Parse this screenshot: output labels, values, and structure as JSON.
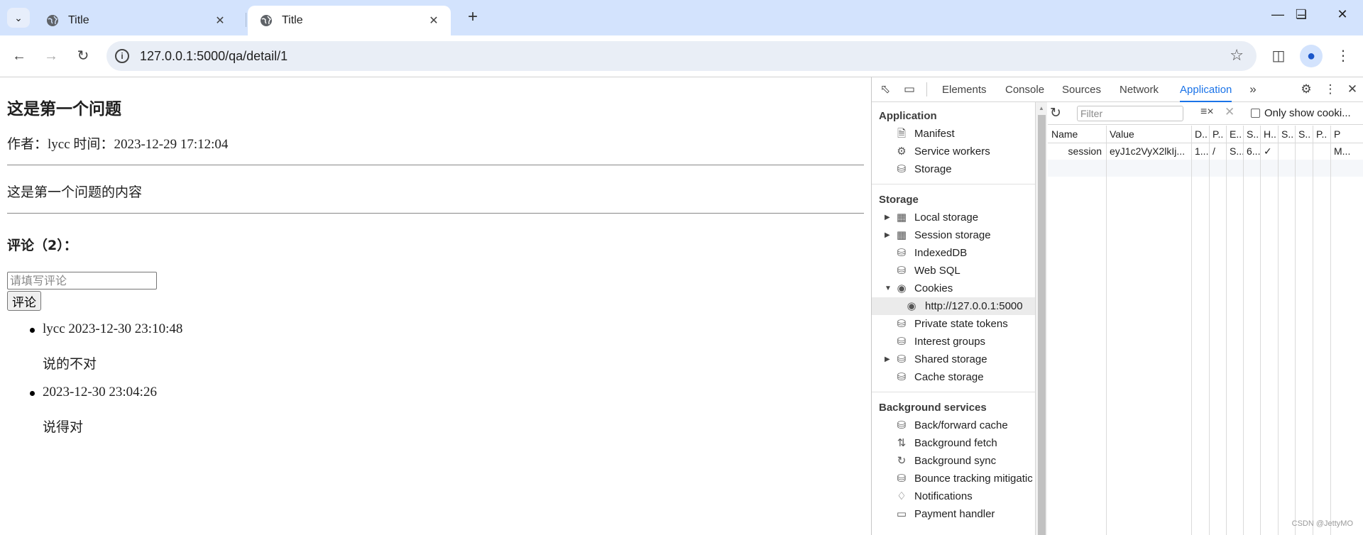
{
  "browser": {
    "tabs": [
      {
        "title": "Title",
        "active": false
      },
      {
        "title": "Title",
        "active": true
      }
    ],
    "url": "127.0.0.1:5000/qa/detail/1"
  },
  "page": {
    "question_title": "这是第一个问题",
    "author_label": "作者：",
    "author": "lycc",
    "time_label": "时间：",
    "time": "2023-12-29 17:12:04",
    "content": "这是第一个问题的内容",
    "comments_heading": "评论（2）：",
    "comment_placeholder": "请填写评论",
    "comment_button": "评论",
    "comments": [
      {
        "head": "lycc 2023-12-30 23:10:48",
        "body": "说的不对"
      },
      {
        "head": "2023-12-30 23:04:26",
        "body": "说得对"
      }
    ]
  },
  "devtools": {
    "tabs": [
      "Elements",
      "Console",
      "Sources",
      "Network",
      "Application"
    ],
    "active_tab": "Application",
    "sidebar": {
      "sections": [
        {
          "title": "Application",
          "items": [
            {
              "label": "Manifest",
              "icon": "file-icon"
            },
            {
              "label": "Service workers",
              "icon": "gears-icon"
            },
            {
              "label": "Storage",
              "icon": "database-icon"
            }
          ]
        },
        {
          "title": "Storage",
          "items": [
            {
              "label": "Local storage",
              "icon": "table-icon"
            },
            {
              "label": "Session storage",
              "icon": "table-icon"
            },
            {
              "label": "IndexedDB",
              "icon": "database-icon"
            },
            {
              "label": "Web SQL",
              "icon": "database-icon"
            },
            {
              "label": "Cookies",
              "icon": "cookie-icon"
            },
            {
              "label": "http://127.0.0.1:5000",
              "icon": "cookie-icon"
            },
            {
              "label": "Private state tokens",
              "icon": "database-icon"
            },
            {
              "label": "Interest groups",
              "icon": "database-icon"
            },
            {
              "label": "Shared storage",
              "icon": "database-icon"
            },
            {
              "label": "Cache storage",
              "icon": "database-icon"
            }
          ]
        },
        {
          "title": "Background services",
          "items": [
            {
              "label": "Back/forward cache",
              "icon": "database-icon"
            },
            {
              "label": "Background fetch",
              "icon": "arrows-updown-icon"
            },
            {
              "label": "Background sync",
              "icon": "sync-icon"
            },
            {
              "label": "Bounce tracking mitigatic",
              "icon": "database-icon"
            },
            {
              "label": "Notifications",
              "icon": "bell-icon"
            },
            {
              "label": "Payment handler",
              "icon": "card-icon"
            }
          ]
        }
      ]
    },
    "filter_placeholder": "Filter",
    "only_show_label": "Only show cooki...",
    "columns": [
      "Name",
      "Value",
      "D..",
      "P..",
      "E..",
      "S..",
      "H..",
      "S..",
      "S..",
      "P..",
      "P"
    ],
    "cookie_row": [
      "session",
      "eyJ1c2VyX2lkIj...",
      "1...",
      "/",
      "S...",
      "6...",
      "✓",
      "",
      "",
      "",
      "M..."
    ]
  },
  "watermark": "CSDN @JettyMO"
}
